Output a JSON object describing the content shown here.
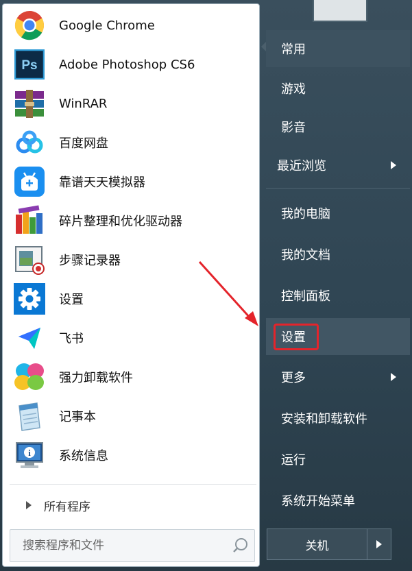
{
  "programs": [
    {
      "label": "Google Chrome",
      "icon": "chrome-icon"
    },
    {
      "label": "Adobe Photoshop CS6",
      "icon": "photoshop-icon"
    },
    {
      "label": "WinRAR",
      "icon": "winrar-icon"
    },
    {
      "label": "百度网盘",
      "icon": "baidu-netdisk-icon"
    },
    {
      "label": "靠谱天天模拟器",
      "icon": "emulator-icon"
    },
    {
      "label": "碎片整理和优化驱动器",
      "icon": "defrag-icon"
    },
    {
      "label": "步骤记录器",
      "icon": "steps-recorder-icon"
    },
    {
      "label": "设置",
      "icon": "settings-gear-icon"
    },
    {
      "label": "飞书",
      "icon": "feishu-icon"
    },
    {
      "label": "强力卸载软件",
      "icon": "uninstaller-icon"
    },
    {
      "label": "记事本",
      "icon": "notepad-icon"
    },
    {
      "label": "系统信息",
      "icon": "system-info-icon"
    }
  ],
  "all_programs": "所有程序",
  "search": {
    "placeholder": "搜索程序和文件"
  },
  "right_menu": {
    "common": "常用",
    "games": "游戏",
    "media": "影音",
    "recent": "最近浏览",
    "my_computer": "我的电脑",
    "my_documents": "我的文档",
    "control_panel": "控制面板",
    "settings": "设置",
    "more": "更多",
    "install_uninstall": "安装和卸载软件",
    "run": "运行",
    "start_menu": "系统开始菜单"
  },
  "shutdown": {
    "label": "关机"
  },
  "colors": {
    "annotation_red": "#e4242b",
    "panel_bg": "#2b3e4b"
  }
}
